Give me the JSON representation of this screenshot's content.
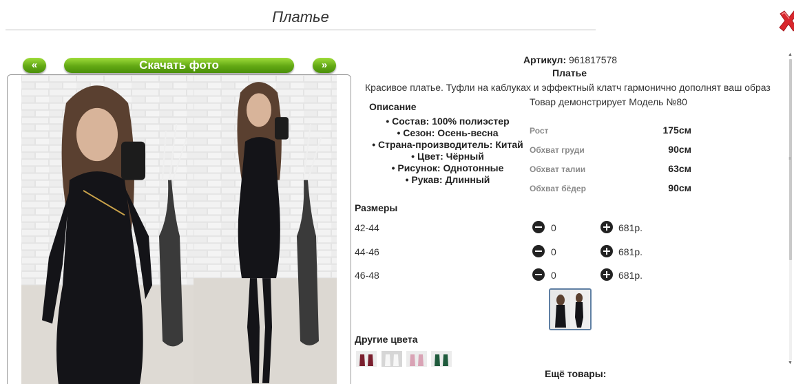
{
  "header": {
    "title": "Платье"
  },
  "gallery": {
    "prev_label": "«",
    "next_label": "»",
    "download_label": "Скачать фото"
  },
  "product": {
    "article_label": "Артикул:",
    "article_value": "961817578",
    "name": "Платье",
    "description": "Красивое платье. Туфли на каблуках и эффектный клатч гармонично дополнят ваш образ",
    "model_note": "Товар демонстрирует Модель №80"
  },
  "description_block": {
    "heading": "Описание",
    "properties": [
      "Состав: 100% полиэстер",
      "Сезон: Осень-весна",
      "Страна-производитель: Китай",
      "Цвет: Чёрный",
      "Рисунок: Однотонные",
      "Рукав: Длинный"
    ]
  },
  "measurements": [
    {
      "label": "Рост",
      "value": "175см"
    },
    {
      "label": "Обхват груди",
      "value": "90см"
    },
    {
      "label": "Обхват талии",
      "value": "63см"
    },
    {
      "label": "Обхват бёдер",
      "value": "90см"
    }
  ],
  "sizes": {
    "heading": "Размеры",
    "rows": [
      {
        "label": "42-44",
        "qty": "0",
        "price": "681р."
      },
      {
        "label": "44-46",
        "qty": "0",
        "price": "681р."
      },
      {
        "label": "46-48",
        "qty": "0",
        "price": "681р."
      }
    ]
  },
  "other_colors": {
    "heading": "Другие цвета",
    "swatch_colors": [
      "#7a1f2e",
      "#e9e9e9",
      "#d9a3b5",
      "#1f5a3c"
    ]
  },
  "more_products": {
    "heading": "Ещё товары:"
  },
  "colors": {
    "accent_green": "#62a814",
    "close_red": "#d9262c",
    "dress": "#141418",
    "hair": "#5a4030"
  }
}
